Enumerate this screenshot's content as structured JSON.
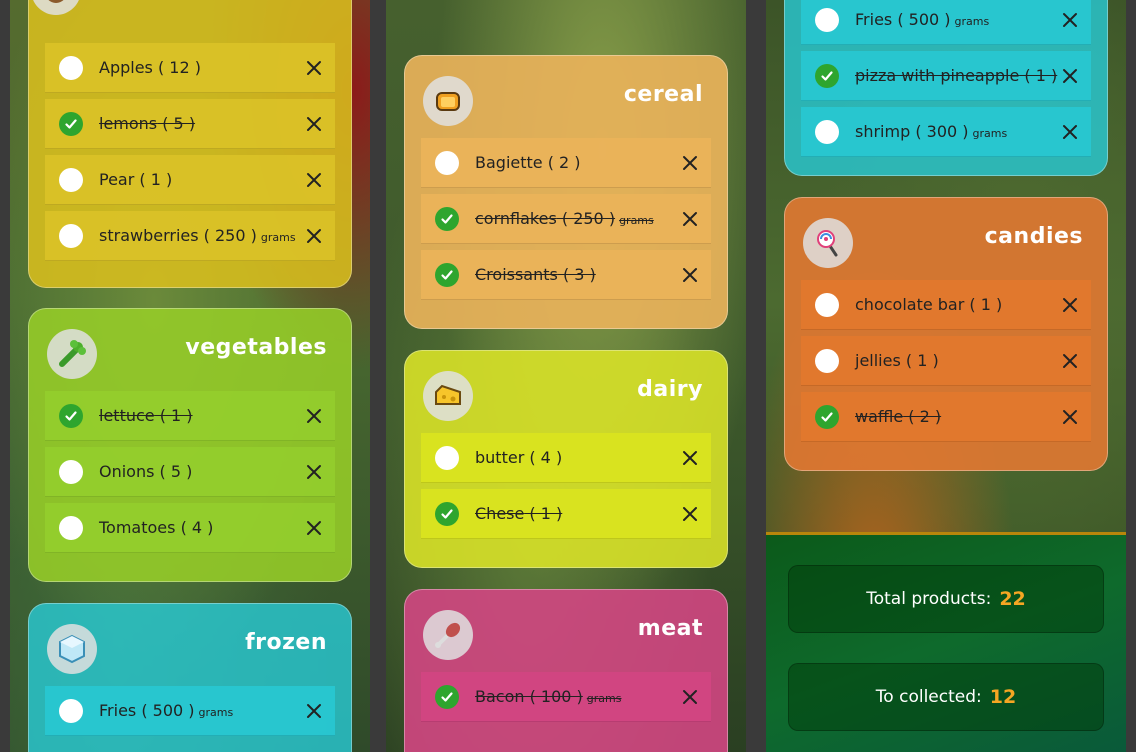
{
  "columns": {
    "col1": {
      "fruits": {
        "title": "",
        "items": [
          {
            "name": "Apples",
            "qty": "( 12 )",
            "unit": "",
            "done": false
          },
          {
            "name": "lemons",
            "qty": "( 5 )",
            "unit": "",
            "done": true
          },
          {
            "name": "Pear",
            "qty": "( 1 )",
            "unit": "",
            "done": false
          },
          {
            "name": "strawberries",
            "qty": "( 250 )",
            "unit": "grams",
            "done": false
          }
        ]
      },
      "vegetables": {
        "title": "vegetables",
        "items": [
          {
            "name": "lettuce",
            "qty": "( 1 )",
            "unit": "",
            "done": true
          },
          {
            "name": "Onions",
            "qty": "( 5 )",
            "unit": "",
            "done": false
          },
          {
            "name": "Tomatoes",
            "qty": "( 4 )",
            "unit": "",
            "done": false
          }
        ]
      },
      "frozen": {
        "title": "frozen",
        "items": [
          {
            "name": "Fries",
            "qty": "( 500 )",
            "unit": "grams",
            "done": false
          }
        ]
      }
    },
    "col2": {
      "cereal": {
        "title": "cereal",
        "items": [
          {
            "name": "Bagiette",
            "qty": "( 2 )",
            "unit": "",
            "done": false
          },
          {
            "name": "cornflakes",
            "qty": "( 250 )",
            "unit": "grams",
            "done": true
          },
          {
            "name": "Croissants",
            "qty": "( 3 )",
            "unit": "",
            "done": true
          }
        ]
      },
      "dairy": {
        "title": "dairy",
        "items": [
          {
            "name": "butter",
            "qty": "( 4 )",
            "unit": "",
            "done": false
          },
          {
            "name": "Chese",
            "qty": "( 1 )",
            "unit": "",
            "done": true
          }
        ]
      },
      "meat": {
        "title": "meat",
        "items": [
          {
            "name": "Bacon",
            "qty": "( 100 )",
            "unit": "grams",
            "done": true
          }
        ]
      }
    },
    "col3": {
      "frozen_cont": {
        "items": [
          {
            "name": "Fries",
            "qty": "( 500 )",
            "unit": "grams",
            "done": false
          },
          {
            "name": "pizza with pineapple",
            "qty": "( 1 )",
            "unit": "",
            "done": true
          },
          {
            "name": "shrimp",
            "qty": "( 300 )",
            "unit": "grams",
            "done": false
          }
        ]
      },
      "candies": {
        "title": "candies",
        "items": [
          {
            "name": "chocolate bar",
            "qty": "( 1 )",
            "unit": "",
            "done": false
          },
          {
            "name": "jellies",
            "qty": "( 1 )",
            "unit": "",
            "done": false
          },
          {
            "name": "waffle",
            "qty": "( 2 )",
            "unit": "",
            "done": true
          }
        ]
      }
    }
  },
  "summary": {
    "total_label": "Total products:",
    "total_value": "22",
    "collected_label": "To collected:",
    "collected_value": "12"
  },
  "colors": {
    "check_on": "#2ea52e",
    "accent_number": "#f5a623"
  }
}
